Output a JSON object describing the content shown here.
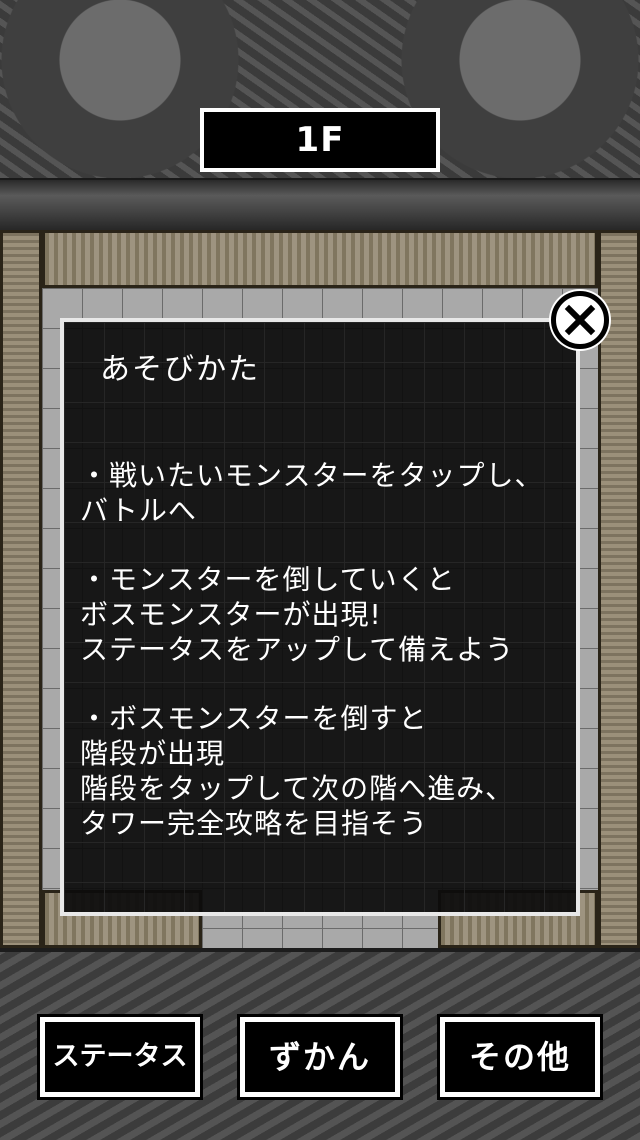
{
  "floor": {
    "label": "1F"
  },
  "dialog": {
    "title": "あそびかた",
    "instructions": [
      "・戦いたいモンスターをタップし、\nバトルへ",
      "・モンスターを倒していくと\nボスモンスターが出現!\nステータスをアップして備えよう",
      "・ボスモンスターを倒すと\n階段が出現\n階段をタップして次の階へ進み、\nタワー完全攻略を目指そう"
    ],
    "close_icon": "close-x-icon"
  },
  "nav": {
    "status_label": "ステータス",
    "zukan_label": "ずかん",
    "other_label": "その他"
  }
}
